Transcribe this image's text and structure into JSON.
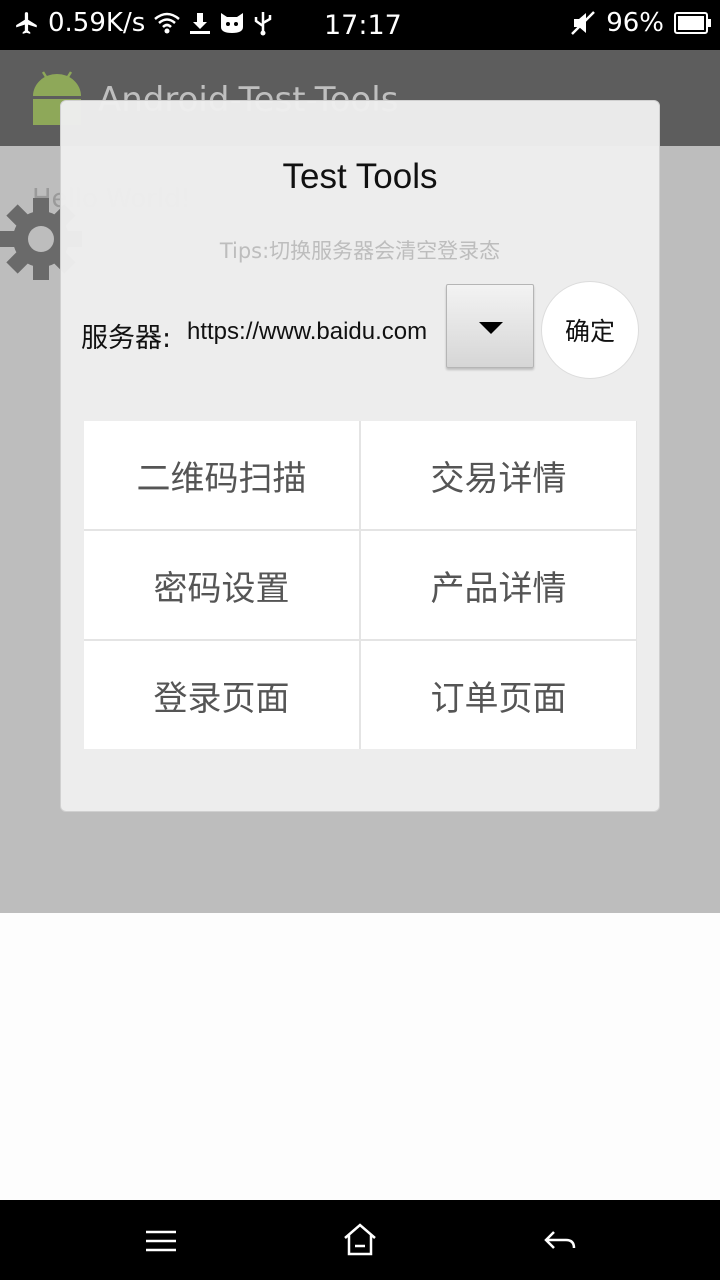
{
  "status_bar": {
    "net_speed": "0.59K/s",
    "time": "17:17",
    "battery": "96%",
    "icons": [
      "airplane-icon",
      "wifi-icon",
      "download-icon",
      "cat-icon",
      "usb-icon",
      "mute-icon",
      "battery-icon"
    ]
  },
  "app": {
    "title": "Android-Test-Tools",
    "hello": "Hello World!"
  },
  "dialog": {
    "title": "Test Tools",
    "tips": "Tips:切换服务器会清空登录态",
    "server_label": "服务器:",
    "server_value": "https://www.baidu.com",
    "confirm_label": "确定",
    "grid": [
      {
        "label": "二维码扫描"
      },
      {
        "label": "交易详情"
      },
      {
        "label": "密码设置"
      },
      {
        "label": "产品详情"
      },
      {
        "label": "登录页面"
      },
      {
        "label": "订单页面"
      }
    ]
  },
  "nav_bar": {
    "icons": [
      "menu-icon",
      "home-icon",
      "back-icon"
    ]
  },
  "colors": {
    "status_bar": "#000000",
    "action_bar": "#5d5d5d",
    "dim_overlay": "#bdbdbd",
    "dialog_bg": "#eeeeee",
    "android_green": "#a4c639"
  }
}
